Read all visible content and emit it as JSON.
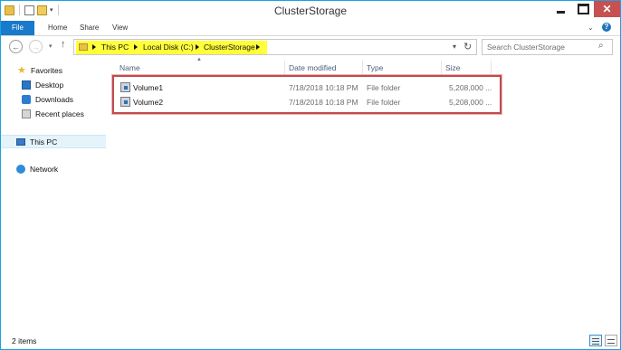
{
  "window": {
    "title": "ClusterStorage"
  },
  "ribbon": {
    "tabs": [
      "File",
      "Home",
      "Share",
      "View"
    ]
  },
  "address": {
    "crumbs": [
      "This PC",
      "Local Disk (C:)",
      "ClusterStorage"
    ]
  },
  "search": {
    "placeholder": "Search ClusterStorage"
  },
  "navpane": {
    "favorites": "Favorites",
    "desktop": "Desktop",
    "downloads": "Downloads",
    "recent": "Recent places",
    "thispc": "This PC",
    "network": "Network"
  },
  "columns": {
    "name": "Name",
    "date": "Date modified",
    "type": "Type",
    "size": "Size"
  },
  "files": [
    {
      "name": "Volume1",
      "date": "7/18/2018 10:18 PM",
      "type": "File folder",
      "size": "5,208,000 ..."
    },
    {
      "name": "Volume2",
      "date": "7/18/2018 10:18 PM",
      "type": "File folder",
      "size": "5,208,000 ..."
    }
  ],
  "status": {
    "count": "2 items"
  },
  "colors": {
    "accent": "#1979ca",
    "highlight": "#ffff3a",
    "redbox": "#c24a4a",
    "close": "#c75050"
  }
}
